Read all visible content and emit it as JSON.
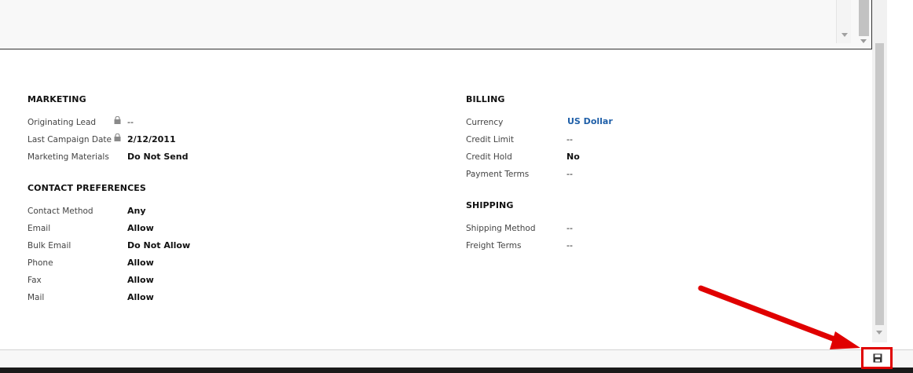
{
  "marketing": {
    "title": "MARKETING",
    "fields": [
      {
        "label": "Originating Lead",
        "value": "--",
        "locked": true
      },
      {
        "label": "Last Campaign Date",
        "value": "2/12/2011",
        "locked": true
      },
      {
        "label": "Marketing Materials",
        "value": "Do Not Send",
        "locked": false
      }
    ]
  },
  "contact_preferences": {
    "title": "CONTACT PREFERENCES",
    "fields": [
      {
        "label": "Contact Method",
        "value": "Any"
      },
      {
        "label": "Email",
        "value": "Allow"
      },
      {
        "label": "Bulk Email",
        "value": "Do Not Allow"
      },
      {
        "label": "Phone",
        "value": "Allow"
      },
      {
        "label": "Fax",
        "value": "Allow"
      },
      {
        "label": "Mail",
        "value": "Allow"
      }
    ]
  },
  "billing": {
    "title": "BILLING",
    "fields": [
      {
        "label": "Currency",
        "value": "US Dollar"
      },
      {
        "label": "Credit Limit",
        "value": "--"
      },
      {
        "label": "Credit Hold",
        "value": "No"
      },
      {
        "label": "Payment Terms",
        "value": "--"
      }
    ]
  },
  "shipping": {
    "title": "SHIPPING",
    "fields": [
      {
        "label": "Shipping Method",
        "value": "--"
      },
      {
        "label": "Freight Terms",
        "value": "--"
      }
    ]
  },
  "icons": {
    "lock": "lock-icon",
    "save": "save-icon"
  },
  "colors": {
    "link": "#1f5fa8",
    "highlight": "#e00000"
  }
}
